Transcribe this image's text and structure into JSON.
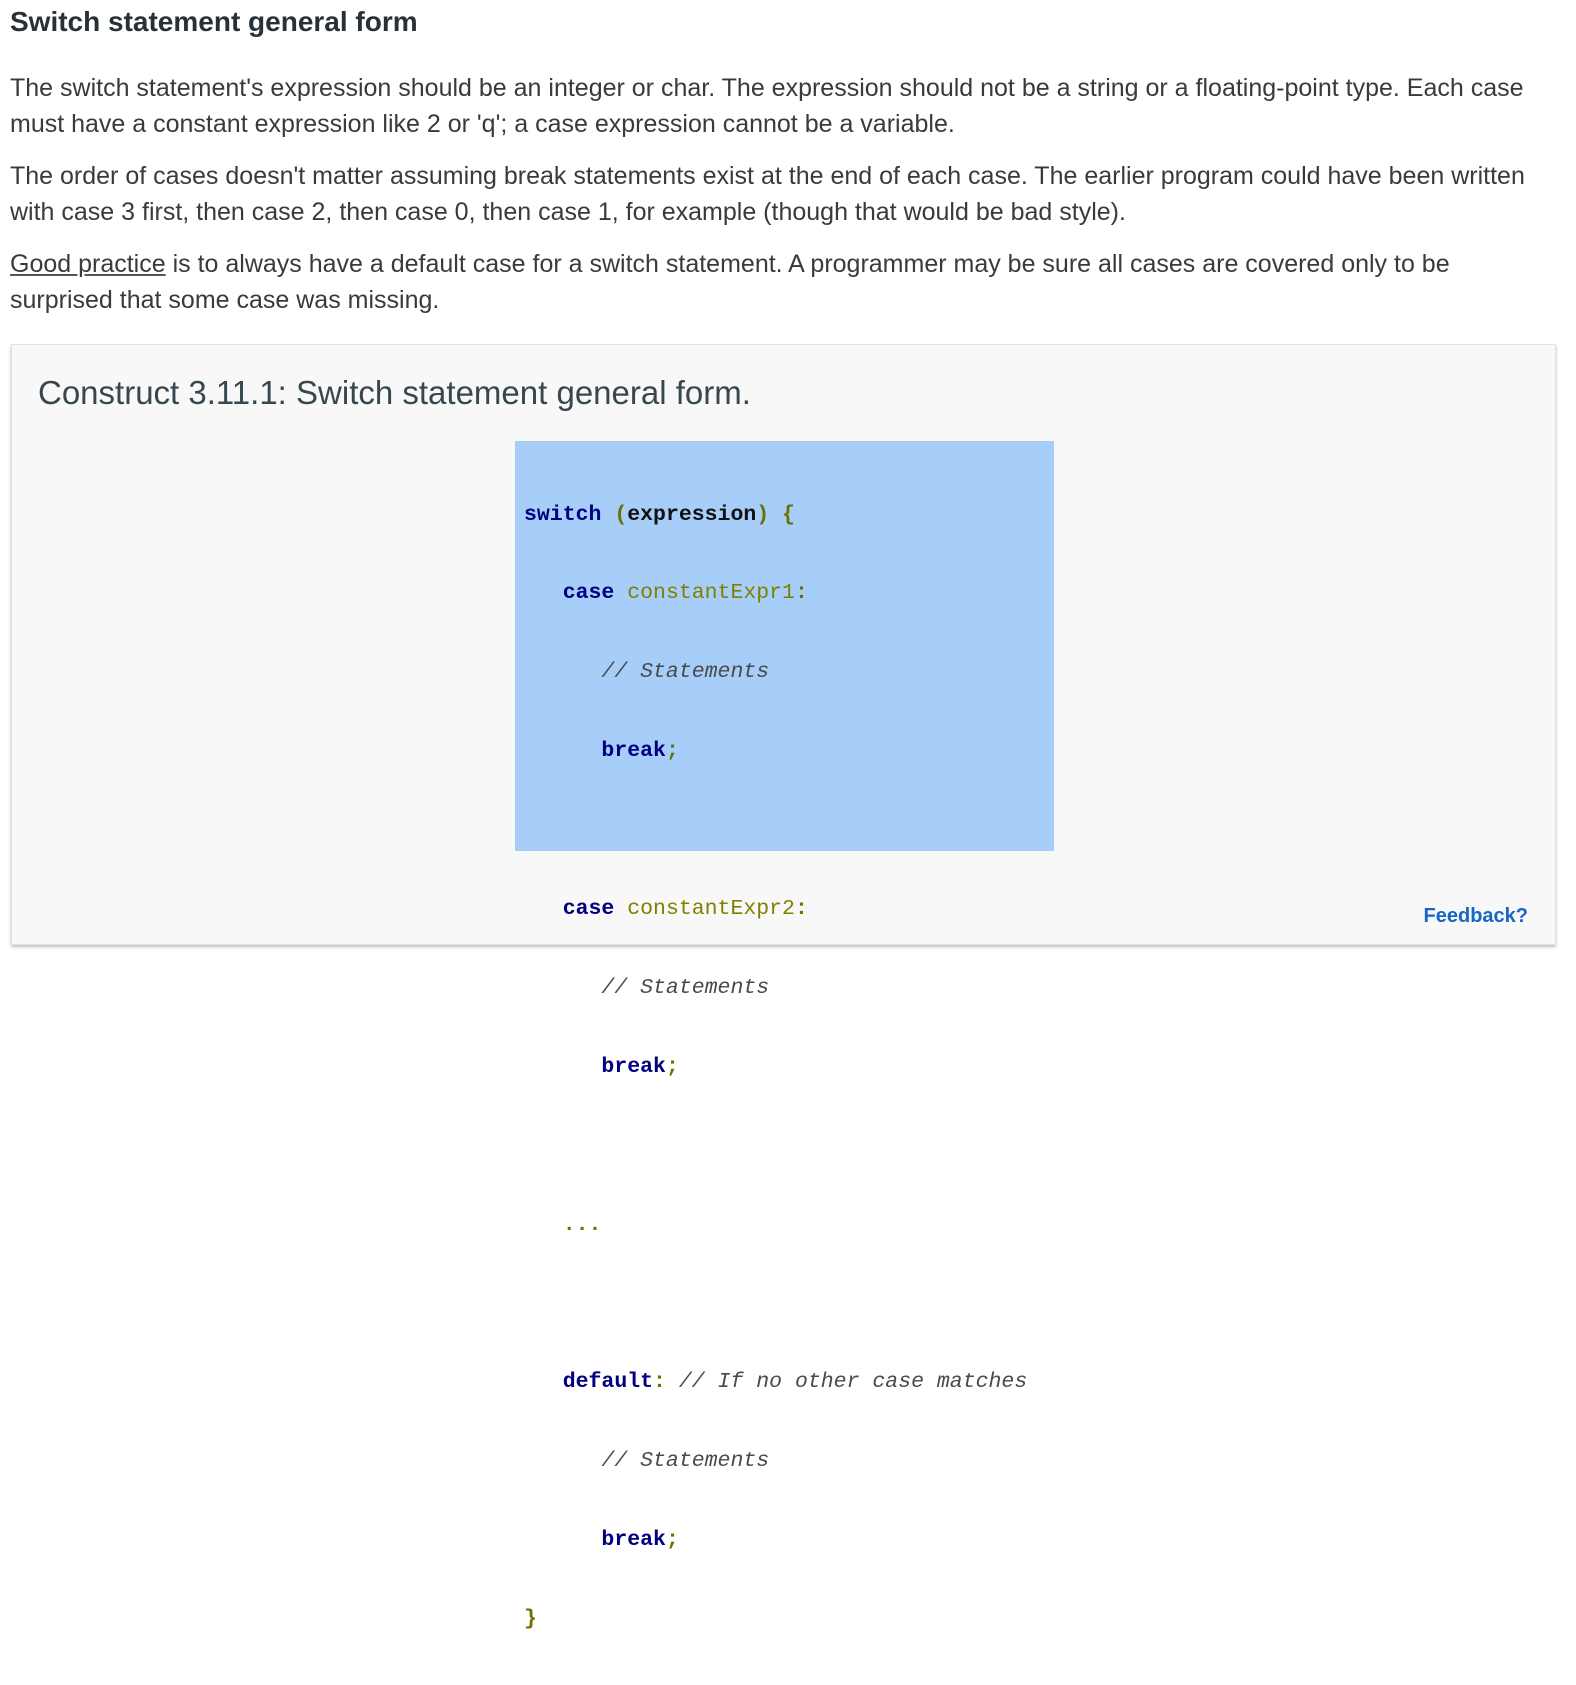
{
  "section": {
    "title": "Switch statement general form"
  },
  "paragraphs": {
    "p1": "The switch statement's expression should be an integer or char. The expression should not be a string or a floating-point type. Each case must have a constant expression like 2 or 'q'; a case expression cannot be a variable.",
    "p2": "The order of cases doesn't matter assuming break statements exist at the end of each case. The earlier program could have been written with case 3 first, then case 2, then case 0, then case 1, for example (though that would be bad style).",
    "p3_link": "Good practice",
    "p3_rest": " is to always have a default case for a switch statement. A programmer may be sure all cases are covered only to be surprised that some case was missing."
  },
  "construct": {
    "title": "Construct 3.11.1: Switch statement general form.",
    "feedback_label": "Feedback?",
    "code": {
      "kw_switch": "switch",
      "open_paren": " (",
      "expression": "expression",
      "close_brace_open": ") {",
      "kw_case": "case",
      "const1": "constantExpr1",
      "const2": "constantExpr2",
      "colon": ":",
      "comment_statements": "// Statements",
      "kw_break": "break",
      "semicolon": ";",
      "ellipsis": "...",
      "kw_default": "default",
      "comment_default": "// If no other case matches",
      "close_brace": "}"
    }
  }
}
